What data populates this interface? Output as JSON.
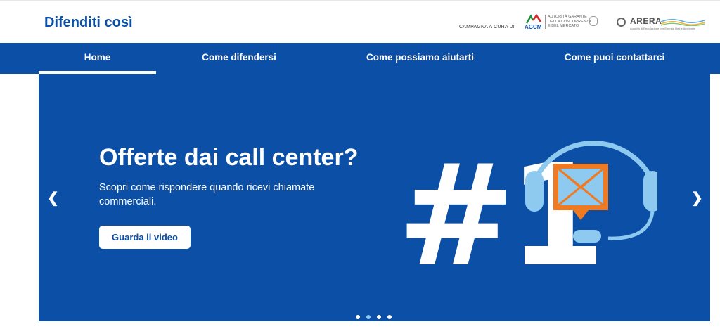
{
  "header": {
    "site_title": "Difenditi così",
    "campaign_label": "CAMPAGNA A CURA DI",
    "agcm": {
      "abbr": "AGCM",
      "lines": [
        "AUTORITÀ GARANTE",
        "DELLA CONCORRENZA",
        "E DEL MERCATO"
      ]
    },
    "arera": {
      "name": "ARERA",
      "subtitle": "Autorità di Regolazione per Energia Reti e Ambiente"
    }
  },
  "nav": {
    "items": [
      {
        "label": "Home",
        "active": true
      },
      {
        "label": "Come difendersi",
        "active": false
      },
      {
        "label": "Come possiamo aiutarti",
        "active": false
      },
      {
        "label": "Come puoi contattarci",
        "active": false
      }
    ]
  },
  "hero": {
    "title": "Offerte dai call center?",
    "subtitle": "Scopri come rispondere quando ricevi chiamate commerciali.",
    "button_label": "Guarda il video",
    "illustration_text": "#1",
    "prev_icon": "chevron-left-icon",
    "next_icon": "chevron-right-icon",
    "slide_count": 4,
    "active_slide": 2
  },
  "colors": {
    "brand_blue": "#0b4fa6",
    "accent_light_blue": "#8ec9f0",
    "accent_orange": "#f07a22",
    "white": "#ffffff"
  }
}
